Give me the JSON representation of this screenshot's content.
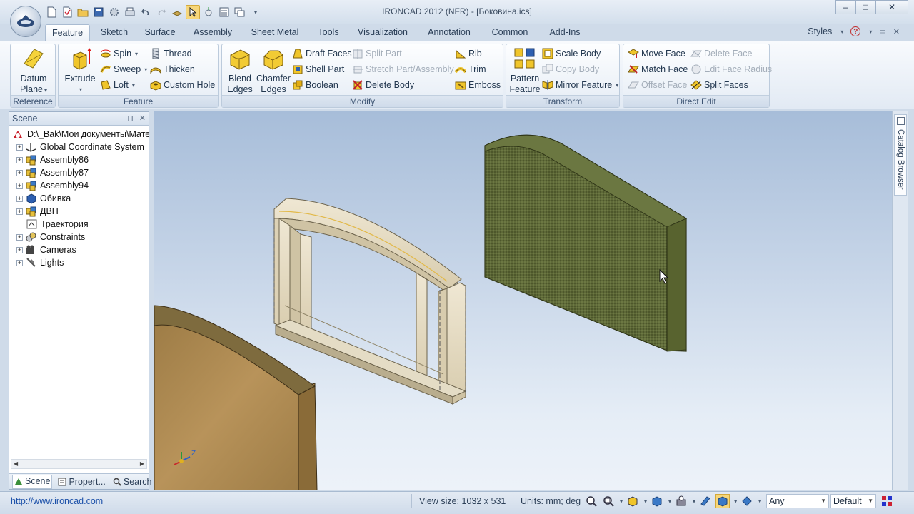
{
  "window": {
    "title": "IRONCAD 2012 (NFR) - [Боковина.ics]",
    "controls": {
      "minimize": "–",
      "maximize": "□",
      "close": "✕"
    }
  },
  "tabs": [
    "Feature",
    "Sketch",
    "Surface",
    "Assembly",
    "Sheet Metal",
    "Tools",
    "Visualization",
    "Annotation",
    "Common",
    "Add-Ins"
  ],
  "active_tab": "Feature",
  "styles_label": "Styles",
  "help_label": "?",
  "ribbon": {
    "reference": {
      "label": "Reference",
      "datum_plane_line1": "Datum",
      "datum_plane_line2": "Plane"
    },
    "feature": {
      "label": "Feature",
      "extrude": "Extrude",
      "spin": "Spin",
      "sweep": "Sweep",
      "loft": "Loft",
      "thread": "Thread",
      "thicken": "Thicken",
      "custom_hole": "Custom Hole"
    },
    "modify": {
      "label": "Modify",
      "blend_line1": "Blend",
      "blend_line2": "Edges",
      "chamfer_line1": "Chamfer",
      "chamfer_line2": "Edges",
      "draft_faces": "Draft Faces",
      "shell_part": "Shell Part",
      "boolean": "Boolean",
      "split_part": "Split Part",
      "stretch": "Stretch Part/Assembly",
      "delete_body": "Delete Body",
      "rib": "Rib",
      "trim": "Trim",
      "emboss": "Emboss"
    },
    "transform": {
      "label": "Transform",
      "pattern_line1": "Pattern",
      "pattern_line2": "Feature",
      "scale_body": "Scale Body",
      "copy_body": "Copy Body",
      "mirror_feature": "Mirror Feature"
    },
    "direct_edit": {
      "label": "Direct Edit",
      "move_face": "Move Face",
      "match_face": "Match Face",
      "offset_face": "Offset Face",
      "delete_face": "Delete Face",
      "edit_face_radius": "Edit Face Radius",
      "split_faces": "Split Faces"
    }
  },
  "scene": {
    "title": "Scene",
    "pin": "⊓",
    "close": "✕",
    "items": [
      {
        "label": "D:\\_Bak\\Мои документы\\Мате",
        "icon": "root-scene-icon"
      },
      {
        "label": "Global Coordinate System",
        "icon": "coordinate-system-icon"
      },
      {
        "label": "Assembly86",
        "icon": "assembly-icon"
      },
      {
        "label": "Assembly87",
        "icon": "assembly-icon"
      },
      {
        "label": "Assembly94",
        "icon": "assembly-icon"
      },
      {
        "label": "Обивка",
        "icon": "part-icon"
      },
      {
        "label": "ДВП",
        "icon": "assembly-icon"
      },
      {
        "label": "Траектория",
        "icon": "sketch-icon"
      },
      {
        "label": "Constraints",
        "icon": "constraints-icon"
      },
      {
        "label": "Cameras",
        "icon": "camera-icon"
      },
      {
        "label": "Lights",
        "icon": "light-icon"
      }
    ],
    "bottom_tabs": [
      "Scene",
      "Propert...",
      "Search"
    ]
  },
  "catalog_browser": "Catalog Browser",
  "axis_labels": {
    "z": "Z"
  },
  "status": {
    "link": "http://www.ironcad.com",
    "view_size": "View size: 1032 x  531",
    "units": "Units: mm; deg",
    "filter": "Any",
    "style": "Default"
  },
  "colors": {
    "accent": "#2a6ac8",
    "ribbon_bg": "#e2eaf4",
    "viewport_top": "#a7bdd9",
    "fabric": "#5b6534",
    "wood": "#b08a4e"
  }
}
